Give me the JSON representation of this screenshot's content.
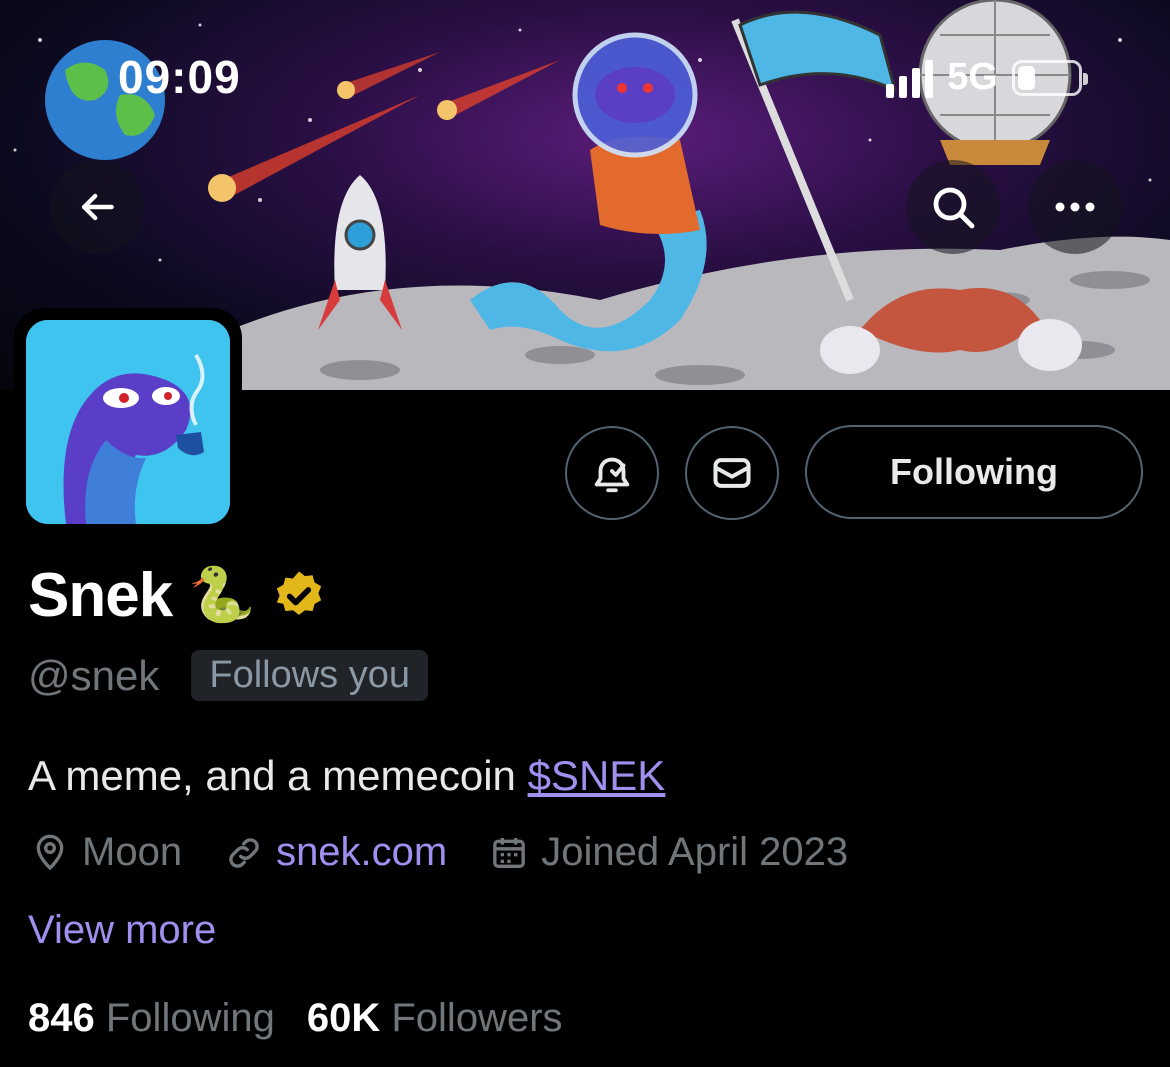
{
  "status_bar": {
    "time": "09:09",
    "network": "5G"
  },
  "profile": {
    "display_name": "Snek",
    "name_emoji": "🐍",
    "handle": "@snek",
    "follows_you_badge": "Follows you",
    "bio_text": "A meme, and a memecoin ",
    "bio_cashtag": "$SNEK",
    "location": "Moon",
    "website": "snek.com",
    "joined": "Joined April 2023",
    "view_more": "View more"
  },
  "actions": {
    "following_label": "Following"
  },
  "stats": {
    "following_count": "846",
    "following_label": "Following",
    "followers_count": "60K",
    "followers_label": "Followers"
  },
  "colors": {
    "accent_link": "#a18ff0",
    "muted_text": "#71767b",
    "verified_gold": "#e2b719",
    "avatar_bg": "#3fc3ef"
  },
  "icons": [
    "back-arrow-icon",
    "search-icon",
    "more-icon",
    "bell-check-icon",
    "mail-icon",
    "verified-badge-icon",
    "location-pin-icon",
    "link-icon",
    "calendar-icon"
  ]
}
